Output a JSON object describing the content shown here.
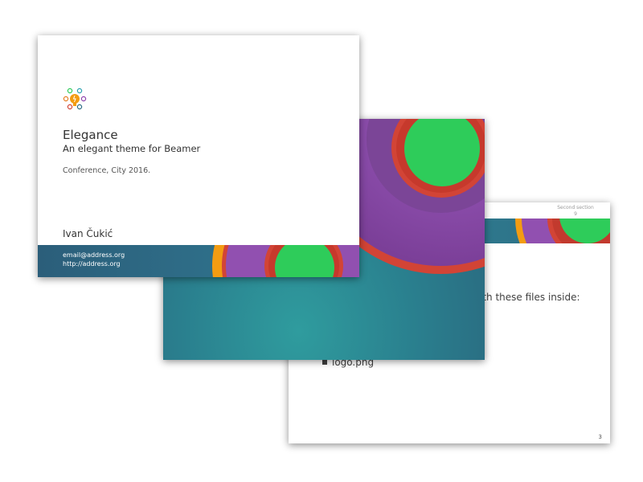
{
  "slide1": {
    "title": "Elegance",
    "subtitle": "An elegant theme for Beamer",
    "conference": "Conference, City 2016.",
    "author": "Ivan Čukić",
    "email": "email@address.org",
    "url": "http://address.org",
    "logo_icon": "lightbulb-gears-icon"
  },
  "slide3": {
    "section_title": "Second section",
    "section_number": "9",
    "body_line": "ith these files inside:",
    "bullet_item": "logo.png",
    "page_number": "3"
  },
  "colors": {
    "band_blue": "#2f6e86",
    "teal_background": "#2a7f8e",
    "purple_ring": "#8e4fa8",
    "red_ring": "#d24436",
    "orange_ring": "#f39c12",
    "green_disc": "#2ecc5a"
  }
}
